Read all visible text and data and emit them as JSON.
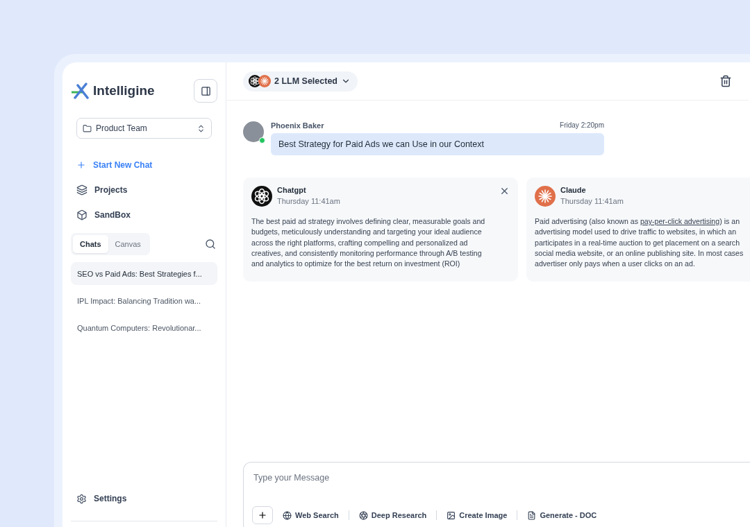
{
  "sidebar": {
    "brand": "Intelligine",
    "workspace": "Product Team",
    "new_chat": "Start New Chat",
    "nav": [
      {
        "label": "Projects",
        "kind": "layers"
      },
      {
        "label": "SandBox",
        "kind": "box"
      }
    ],
    "tabs": [
      {
        "label": "Chats",
        "selected": true
      },
      {
        "label": "Canvas",
        "selected": false
      }
    ],
    "chats": [
      {
        "title": "SEO vs Paid Ads: Best Strategies f...",
        "selected": true
      },
      {
        "title": "IPL Impact: Balancing Tradition wa...",
        "selected": false
      },
      {
        "title": "Quantum Computers: Revolutionar...",
        "selected": false
      }
    ],
    "settings": "Settings"
  },
  "header": {
    "llm_selector": "2 LLM Selected"
  },
  "message": {
    "author": "Phoenix Baker",
    "time": "Friday 2:20pm",
    "text": "Best Strategy for Paid Ads we can Use in our Context",
    "online": true
  },
  "responses": [
    {
      "model": "Chatgpt",
      "kind": "chatgpt",
      "time": "Thursday 11:41am",
      "closable": true,
      "lines": [
        {
          "text": "The best paid ad strategy involves defining clear, measurable goals and"
        },
        {
          "text": "budgets, meticulously understanding and targeting your ideal audience"
        },
        {
          "text": "across the right platforms, crafting compelling and personalized ad"
        },
        {
          "text": "creatives, and consistently monitoring performance through A/B testing"
        },
        {
          "text": "and analytics to optimize for the best return on investment (ROI)"
        }
      ]
    },
    {
      "model": "Claude",
      "kind": "claude",
      "time": "Thursday 11:41am",
      "closable": false,
      "lines": [
        {
          "text": "Paid advertising (also known as ",
          "link": "pay-per-click advertising",
          "after": ") is an"
        },
        {
          "text": "advertising model used to drive traffic to websites, in which an"
        },
        {
          "text": "participates in a real-time auction to get placement on a search"
        },
        {
          "text": "social media website, or an online publishing site. In most cases"
        },
        {
          "text": "advertiser only pays when a user clicks on an ad."
        }
      ]
    }
  ],
  "composer": {
    "placeholder": "Type your Message",
    "tools": [
      {
        "label": "Web Search",
        "kind": "globe"
      },
      {
        "label": "Deep Research",
        "kind": "aperture"
      },
      {
        "label": "Create Image",
        "kind": "image"
      },
      {
        "label": "Generate - DOC",
        "kind": "doc"
      }
    ]
  }
}
